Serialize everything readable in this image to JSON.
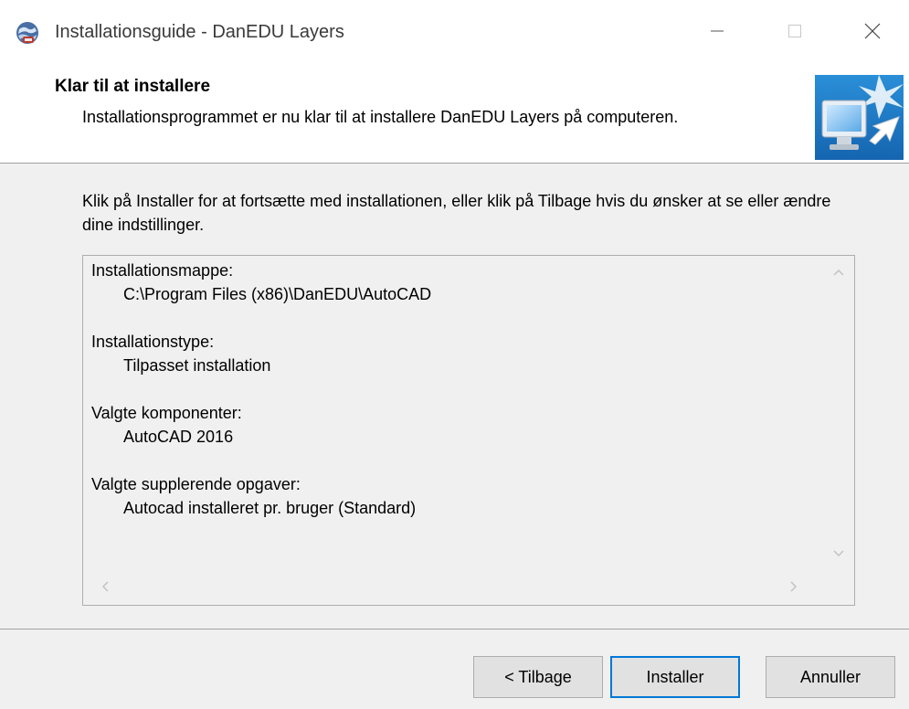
{
  "window": {
    "title": "Installationsguide - DanEDU Layers",
    "controls": {
      "minimize": "minimize-icon",
      "maximize": "maximize-icon",
      "close": "close-icon"
    }
  },
  "header": {
    "title": "Klar til at installere",
    "subtitle": "Installationsprogrammet er nu klar til at installere DanEDU Layers på computeren."
  },
  "body": {
    "intro": "Klik på Installer for at fortsætte med installationen, eller klik på Tilbage hvis du ønsker at se eller ændre dine indstillinger."
  },
  "summary": {
    "groups": [
      {
        "label": "Installationsmappe:",
        "value": "C:\\Program Files (x86)\\DanEDU\\AutoCAD"
      },
      {
        "label": "Installationstype:",
        "value": "Tilpasset installation"
      },
      {
        "label": "Valgte komponenter:",
        "value": "AutoCAD 2016"
      },
      {
        "label": "Valgte supplerende opgaver:",
        "value": "Autocad installeret pr. bruger (Standard)"
      }
    ]
  },
  "buttons": {
    "back": "< Tilbage",
    "install": "Installer",
    "cancel": "Annuller"
  },
  "colors": {
    "focus_border": "#0078d7",
    "panel_bg": "#f0f0f0",
    "header_bg": "#ffffff"
  }
}
